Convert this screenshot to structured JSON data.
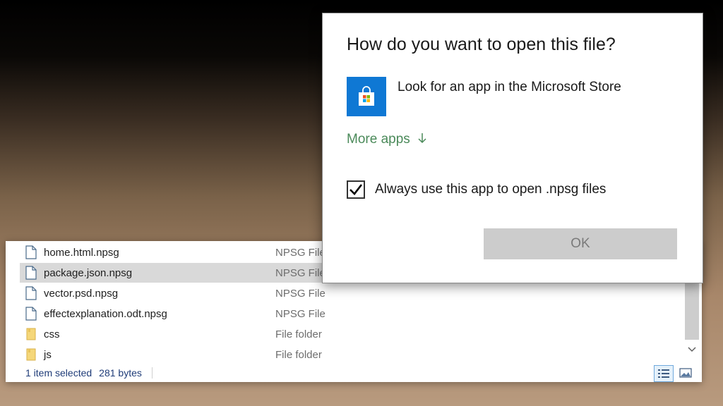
{
  "explorer": {
    "files": [
      {
        "name": "home.html.npsg",
        "type": "NPSG File",
        "icon": "file-icon",
        "selected": false
      },
      {
        "name": "package.json.npsg",
        "type": "NPSG File",
        "icon": "file-icon",
        "selected": true
      },
      {
        "name": "vector.psd.npsg",
        "type": "NPSG File",
        "icon": "file-icon",
        "selected": false
      },
      {
        "name": "effectexplanation.odt.npsg",
        "type": "NPSG File",
        "icon": "file-icon",
        "selected": false
      },
      {
        "name": "css",
        "type": "File folder",
        "icon": "folder-icon",
        "selected": false
      },
      {
        "name": "js",
        "type": "File folder",
        "icon": "folder-icon",
        "selected": false
      }
    ],
    "status": {
      "selection": "1 item selected",
      "size": "281 bytes"
    }
  },
  "dialog": {
    "title": "How do you want to open this file?",
    "store_label": "Look for an app in the Microsoft Store",
    "more_apps_label": "More apps",
    "always_label": "Always use this app to open .npsg files",
    "always_checked": true,
    "ok_label": "OK"
  },
  "colors": {
    "store_tile": "#0f78d4",
    "more_apps": "#4b8a5a",
    "ok_disabled_bg": "#cccccc"
  }
}
